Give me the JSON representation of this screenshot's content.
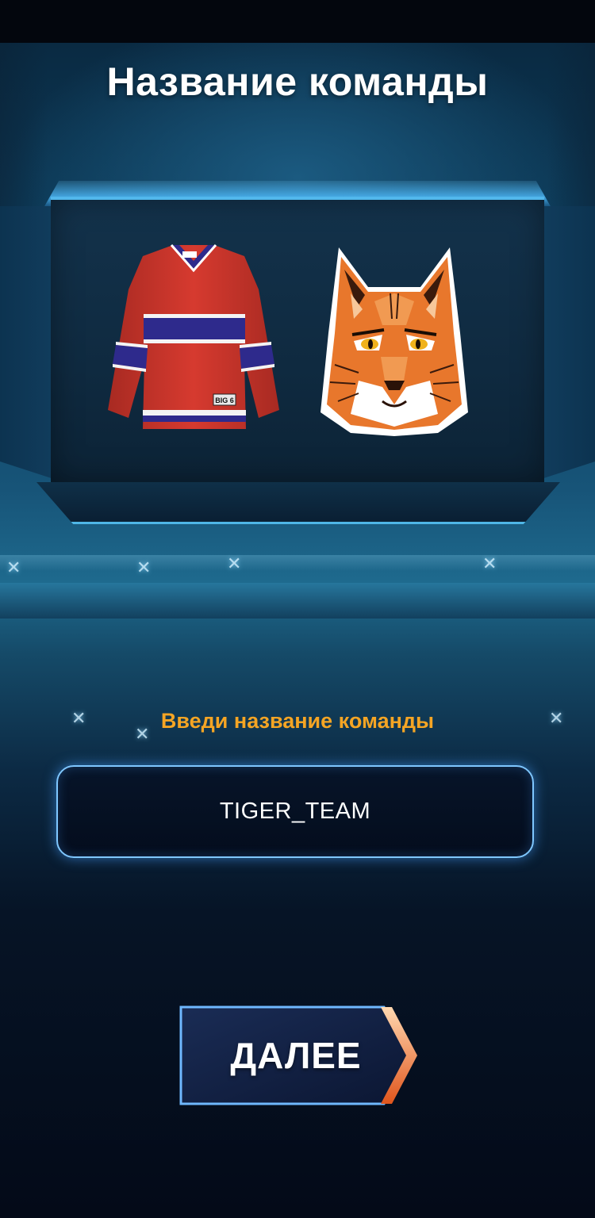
{
  "screen": {
    "title": "Название команды"
  },
  "preview": {
    "jersey_icon": "hockey-jersey-icon",
    "jersey_tag": "BIG 6",
    "logo_icon": "lynx-logo-icon"
  },
  "form": {
    "prompt": "Введи название команды",
    "team_name_value": "TIGER_TEAM"
  },
  "actions": {
    "next_label": "ДАЛЕЕ"
  },
  "colors": {
    "accent_orange": "#f5a524",
    "field_border": "#7fc7ff",
    "jersey_red": "#c8352b",
    "jersey_blue": "#2e2a8c",
    "lynx_orange": "#e8772c"
  }
}
